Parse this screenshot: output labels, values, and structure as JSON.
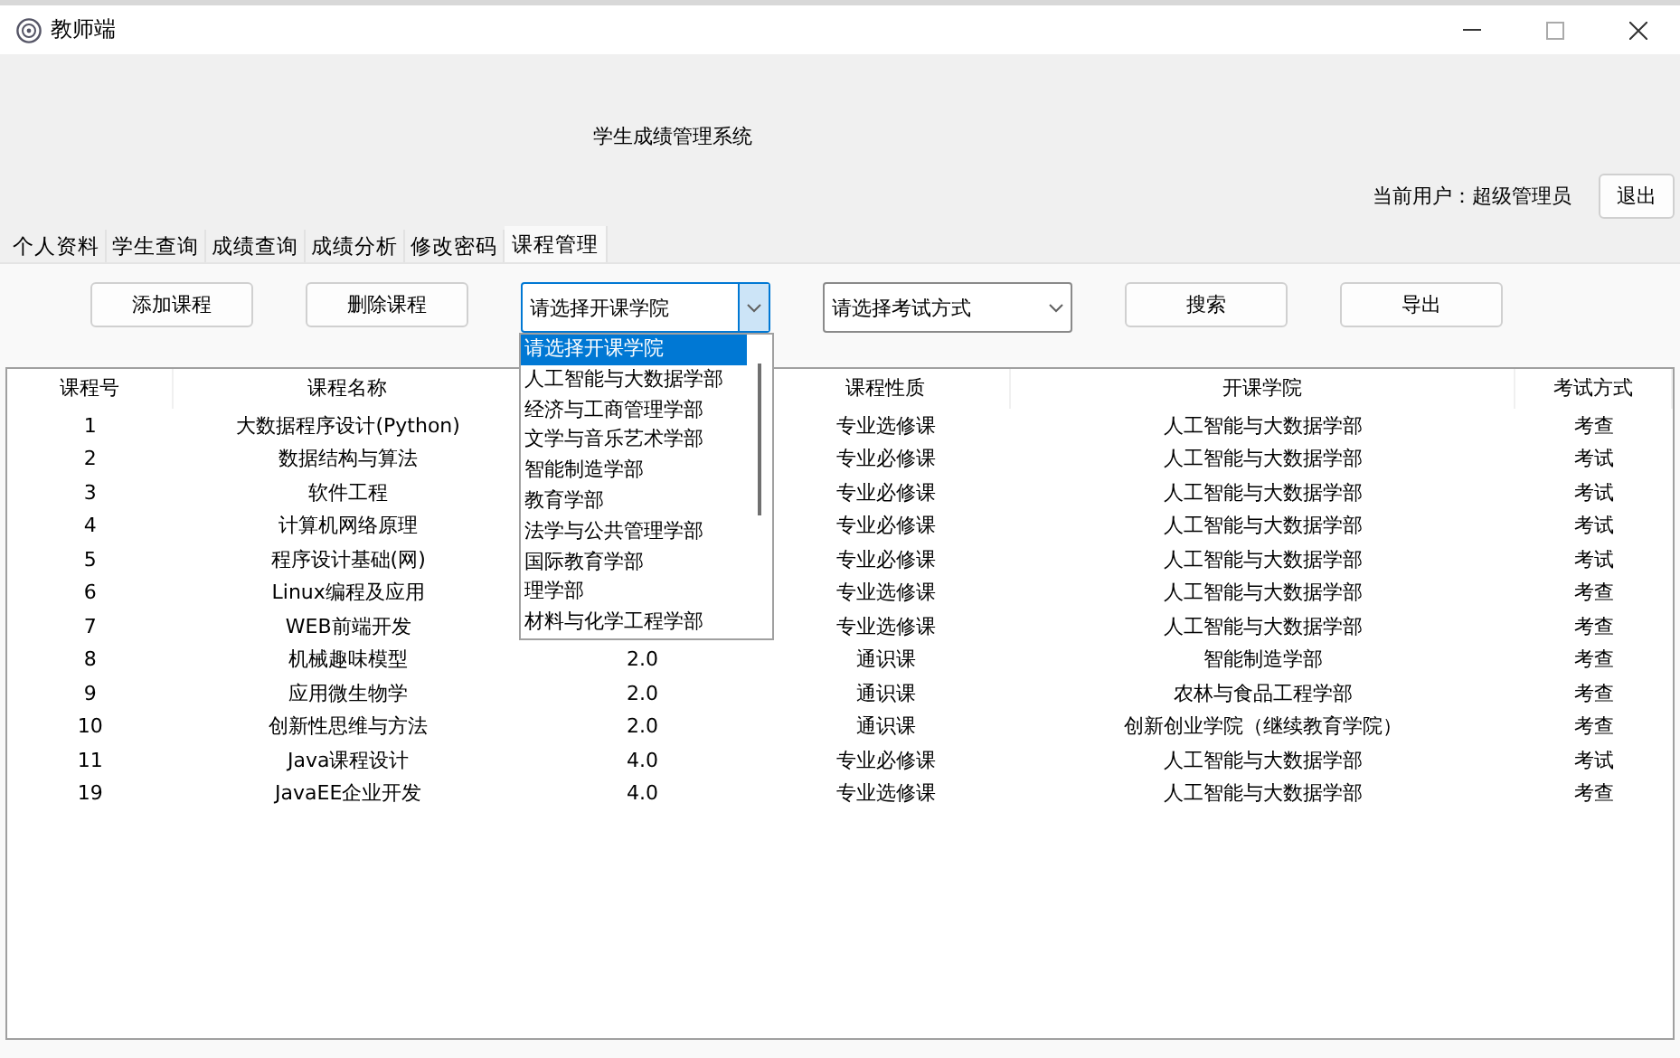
{
  "window": {
    "title": "教师端"
  },
  "header": {
    "system_title": "学生成绩管理系统",
    "current_user": "当前用户：超级管理员",
    "logout_button": "退出"
  },
  "tabs": [
    {
      "label": "个人资料",
      "selected": false
    },
    {
      "label": "学生查询",
      "selected": false
    },
    {
      "label": "成绩查询",
      "selected": false
    },
    {
      "label": "成绩分析",
      "selected": false
    },
    {
      "label": "修改密码",
      "selected": false
    },
    {
      "label": "课程管理",
      "selected": true
    }
  ],
  "toolbar": {
    "add_button": "添加课程",
    "delete_button": "删除课程",
    "college_select": {
      "value": "请选择开课学院",
      "expanded": true,
      "options": [
        {
          "label": "请选择开课学院",
          "selected": true
        },
        {
          "label": "人工智能与大数据学部",
          "selected": false
        },
        {
          "label": "经济与工商管理学部",
          "selected": false
        },
        {
          "label": "文学与音乐艺术学部",
          "selected": false
        },
        {
          "label": "智能制造学部",
          "selected": false
        },
        {
          "label": "教育学部",
          "selected": false
        },
        {
          "label": "法学与公共管理学部",
          "selected": false
        },
        {
          "label": "国际教育学部",
          "selected": false
        },
        {
          "label": "理学部",
          "selected": false
        },
        {
          "label": "材料与化学工程学部",
          "selected": false
        }
      ]
    },
    "exam_select": {
      "value": "请选择考试方式",
      "expanded": false
    },
    "search_button": "搜索",
    "export_button": "导出"
  },
  "table": {
    "columns": {
      "course_no": "课程号",
      "name": "课程名称",
      "nature": "课程性质",
      "college": "开课学院",
      "exam": "考试方式"
    },
    "rows": [
      {
        "course_no": "1",
        "name": "大数据程序设计(Python)",
        "nature": "专业选修课",
        "college": "人工智能与大数据学部",
        "exam": "考查"
      },
      {
        "course_no": "2",
        "name": "数据结构与算法",
        "nature": "专业必修课",
        "college": "人工智能与大数据学部",
        "exam": "考试"
      },
      {
        "course_no": "3",
        "name": "软件工程",
        "nature": "专业必修课",
        "college": "人工智能与大数据学部",
        "exam": "考试"
      },
      {
        "course_no": "4",
        "name": "计算机网络原理",
        "nature": "专业必修课",
        "college": "人工智能与大数据学部",
        "exam": "考试"
      },
      {
        "course_no": "5",
        "name": "程序设计基础(网)",
        "nature": "专业必修课",
        "college": "人工智能与大数据学部",
        "exam": "考试"
      },
      {
        "course_no": "6",
        "name": "Linux编程及应用",
        "nature": "专业选修课",
        "college": "人工智能与大数据学部",
        "exam": "考查"
      },
      {
        "course_no": "7",
        "name": "WEB前端开发",
        "nature": "专业选修课",
        "college": "人工智能与大数据学部",
        "exam": "考查"
      },
      {
        "course_no": "8",
        "name": "机械趣味模型",
        "column_3": "2.0",
        "nature": "通识课",
        "college": "智能制造学部",
        "exam": "考查"
      },
      {
        "course_no": "9",
        "name": "应用微生物学",
        "column_3": "2.0",
        "nature": "通识课",
        "college": "农林与食品工程学部",
        "exam": "考查"
      },
      {
        "course_no": "10",
        "name": "创新性思维与方法",
        "column_3": "2.0",
        "nature": "通识课",
        "college": "创新创业学院（继续教育学院）",
        "exam": "考查"
      },
      {
        "course_no": "11",
        "name": "Java课程设计",
        "column_3": "4.0",
        "nature": "专业必修课",
        "college": "人工智能与大数据学部",
        "exam": "考试"
      },
      {
        "course_no": "19",
        "name": "JavaEE企业开发",
        "column_3": "4.0",
        "nature": "专业选修课",
        "college": "人工智能与大数据学部",
        "exam": "考查"
      }
    ]
  }
}
